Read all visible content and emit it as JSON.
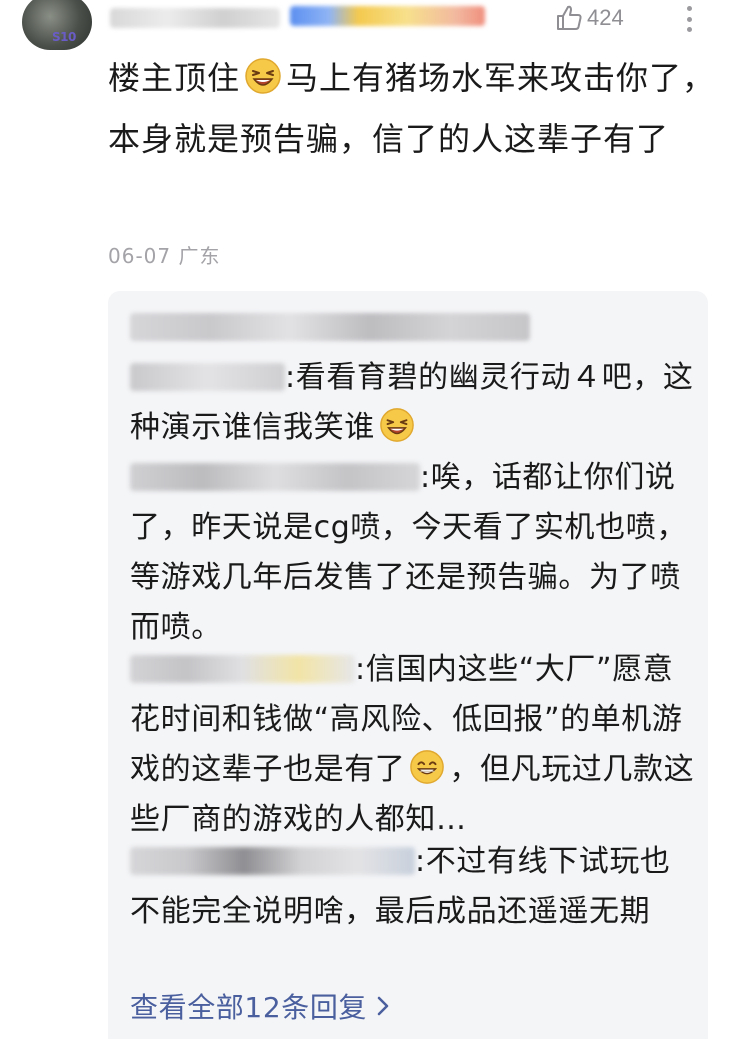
{
  "header": {
    "avatar_badge": "S10",
    "like_count": "424"
  },
  "comment": {
    "text_part1": "楼主顶住",
    "text_part2": "马上有猪场水军来攻击你了，本身就是预告骗，信了的人这辈子有了",
    "date": "06-07",
    "location": "广东"
  },
  "replies": [
    {
      "text_a": "看看育碧的幽灵行动４吧，这种演示谁信我笑谁",
      "text_b": ""
    },
    {
      "text_a": "唉，话都让你们说了，昨天说是cg喷，今天看了实机也喷，等游戏几年后发售了还是预告骗。为了喷而喷。",
      "text_b": ""
    },
    {
      "text_a": "信国内这些“大厂”愿意花时间和钱做“高风险、低回报”的单机游戏的这辈子也是有了",
      "text_b": "，但凡玩过几款这些厂商的游戏的人都知…"
    },
    {
      "text_a": "不过有线下试玩也不能完全说明啥，最后成品还遥遥无期",
      "text_b": ""
    }
  ],
  "view_all_label": "查看全部12条回复",
  "colors": {
    "link": "#4a5f9e",
    "meta": "#a3a3a8",
    "reply_bg": "#f4f5f7"
  }
}
